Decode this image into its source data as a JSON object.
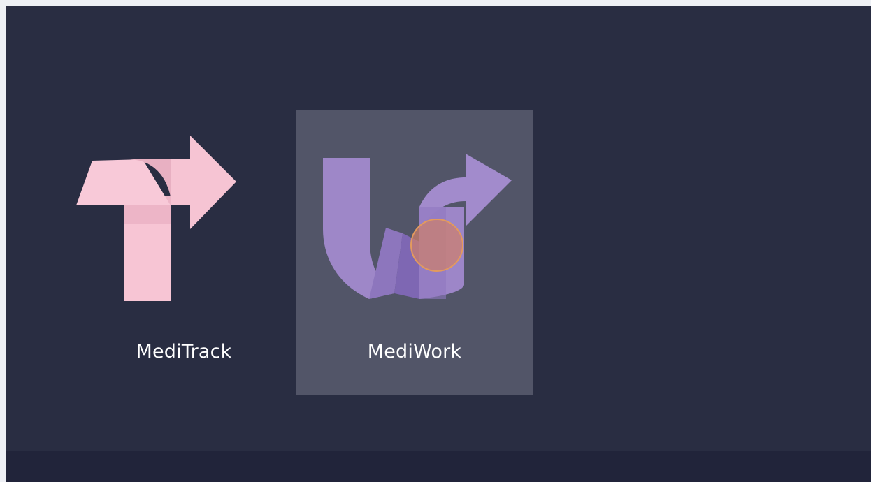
{
  "launcher": {
    "apps": [
      {
        "name": "MediTrack",
        "icon": "meditrack-t-arrow-logo-icon",
        "color": "#f8c7d6",
        "selected": false
      },
      {
        "name": "MediWork",
        "icon": "mediwork-w-arrow-logo-icon",
        "color": "#9f88c9",
        "selected": true
      }
    ]
  },
  "colors": {
    "background": "#292d42",
    "selection": "#525568",
    "bottom_bar": "#21243a",
    "cursor": "#e39a5d"
  }
}
